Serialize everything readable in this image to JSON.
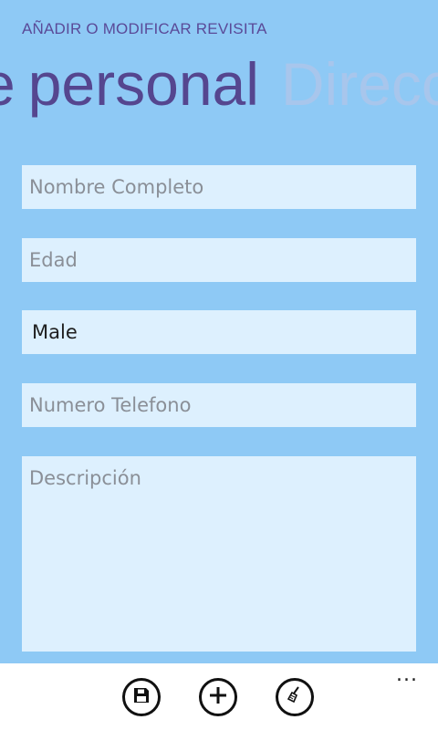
{
  "app": {
    "title": "AÑADIR O MODIFICAR REVISITA"
  },
  "pivot": {
    "items": [
      {
        "label": "personal",
        "active": true
      },
      {
        "label": "Dirección",
        "active": false
      }
    ],
    "partial_prefix": "e"
  },
  "form": {
    "nombre": {
      "placeholder": "Nombre Completo",
      "value": ""
    },
    "edad": {
      "placeholder": "Edad",
      "value": ""
    },
    "genero": {
      "selected": "Male"
    },
    "telefono": {
      "placeholder": "Numero Telefono",
      "value": ""
    },
    "descripcion": {
      "placeholder": "Descripción",
      "value": ""
    }
  },
  "appbar": {
    "buttons": [
      {
        "icon": "save-icon"
      },
      {
        "icon": "add-icon"
      },
      {
        "icon": "broom-icon"
      }
    ],
    "more_label": "..."
  },
  "colors": {
    "background": "#8ec9f5",
    "field": "#ddf0fe",
    "accent": "#55468f",
    "inactive": "#a8c6ec"
  }
}
